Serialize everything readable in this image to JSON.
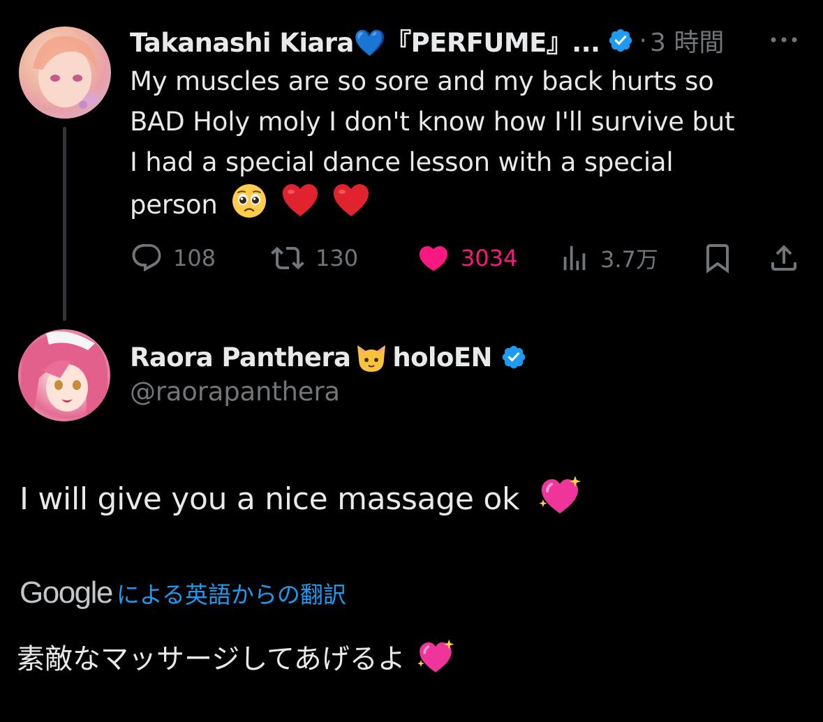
{
  "thread": {
    "parent": {
      "display_name": "Takanashi Kiara💙『PERFUME』...",
      "separator": "·",
      "time": "3 時間",
      "text_lines": [
        "My muscles are so sore and my back hurts so",
        "BAD Holy moly I don't know how I'll survive but",
        "I had a special dance lesson with a special",
        "person"
      ],
      "emojis": [
        "pleading-face-emoji",
        "red-heart-emoji",
        "red-heart-emoji"
      ],
      "actions": {
        "replies": "108",
        "reposts": "130",
        "likes": "3034",
        "views": "3.7万"
      },
      "liked": true
    },
    "reply": {
      "display_name_part1": "Raora Panthera",
      "display_name_part2": "holoEN",
      "name_emoji": "cat-face-emoji",
      "handle": "@raorapanthera",
      "text": "I will give you a nice massage ok",
      "text_emoji": "sparkling-heart-emoji",
      "translation": {
        "brand": "Google",
        "label": "による英語からの翻訳",
        "text": "素敵なマッサージしてあげるよ"
      }
    }
  },
  "colors": {
    "background": "#000000",
    "text_primary": "#e7e9ea",
    "text_secondary": "#71767b",
    "verified_blue": "#1d9bf0",
    "like_pink": "#f91880",
    "link_blue": "#1d9bf0"
  }
}
